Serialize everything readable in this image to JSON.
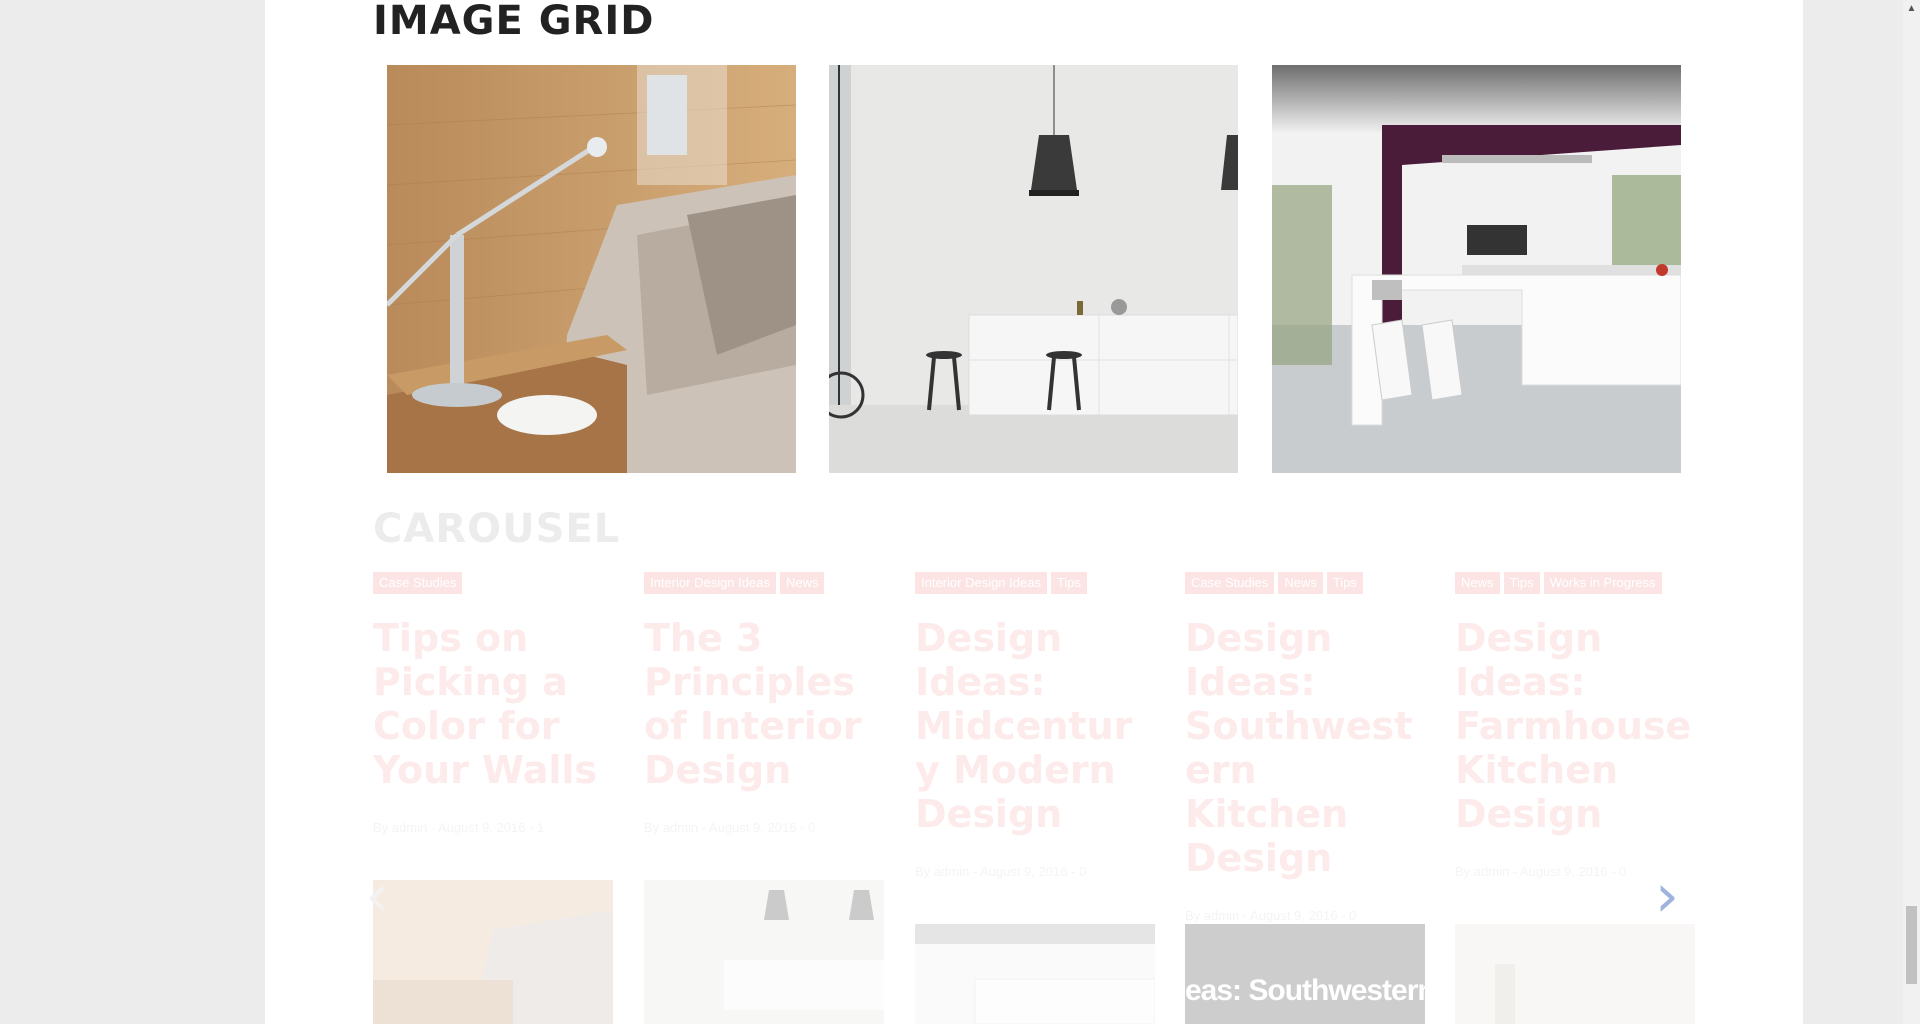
{
  "sections": {
    "image_grid_title": "IMAGE GRID",
    "carousel_title": "CAROUSEL"
  },
  "image_grid": [
    {
      "subject": "bedroom-lamp-photo"
    },
    {
      "subject": "white-kitchen-pendant-photo"
    },
    {
      "subject": "open-kitchen-island-photo"
    }
  ],
  "carousel": {
    "posts": [
      {
        "tags": [
          "Case Studies"
        ],
        "title": "Tips on Picking a Color for Your Walls",
        "meta": "By admin - August 9, 2016 - 1"
      },
      {
        "tags": [
          "Interior Design Ideas",
          "News"
        ],
        "title": "The 3 Principles of Interior Design",
        "meta": "By admin - August 9, 2016 - 0"
      },
      {
        "tags": [
          "Interior Design Ideas",
          "Tips"
        ],
        "title": "Design Ideas: Midcentury Modern Design",
        "meta": "By admin - August 9, 2016 - 0"
      },
      {
        "tags": [
          "Case Studies",
          "News",
          "Tips"
        ],
        "title": "Design Ideas: Southwestern Kitchen Design",
        "meta": "By admin - August 9, 2016 - 0"
      },
      {
        "tags": [
          "News",
          "Tips",
          "Works in Progress"
        ],
        "title": "Design Ideas: Farmhouse Kitchen Design",
        "meta": "By admin - August 9, 2016 - 0"
      }
    ],
    "thumb_overlay_text": "eas: Southwestern Kitch",
    "next_label": "›",
    "prev_label": "‹"
  },
  "colors": {
    "accent": "#e84c3d",
    "carousel_arrow": "#9fb4dd"
  }
}
